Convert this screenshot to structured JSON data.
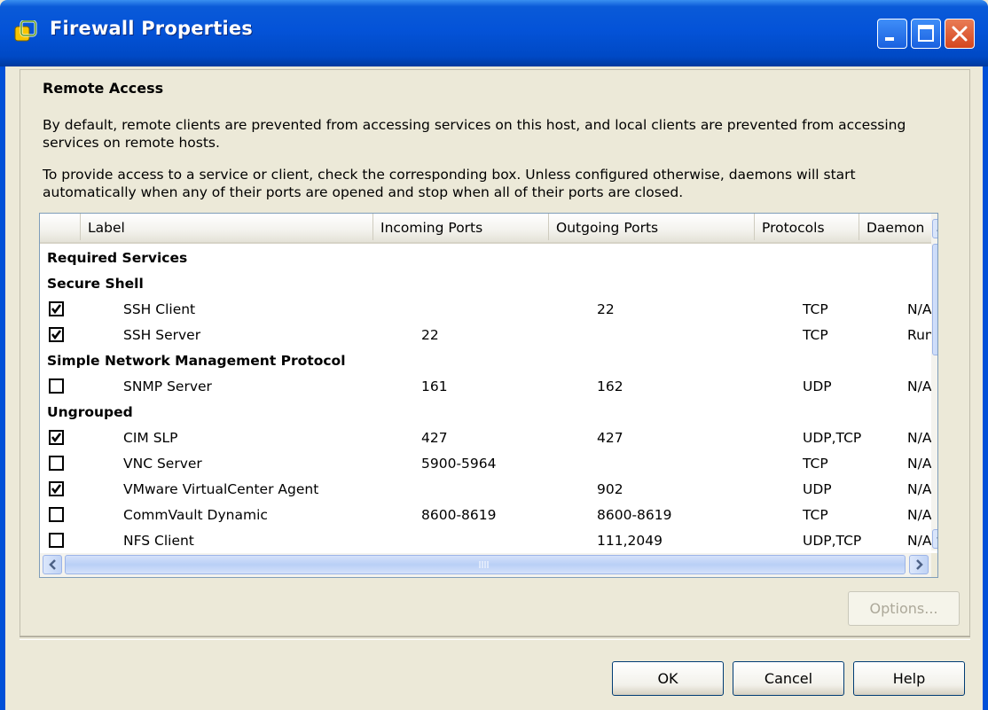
{
  "window": {
    "title": "Firewall Properties"
  },
  "remote_access": {
    "heading": "Remote Access",
    "para1": "By default, remote clients are prevented from accessing services on this host, and local clients are prevented from accessing services on remote hosts.",
    "para2": "To provide access to a service or client, check the corresponding box. Unless configured otherwise, daemons will start automatically when any of their ports are opened and stop when all of their ports are closed."
  },
  "table": {
    "columns": [
      "Label",
      "Incoming Ports",
      "Outgoing Ports",
      "Protocols",
      "Daemon"
    ],
    "rows": [
      {
        "group": "Required Services"
      },
      {
        "group": "Secure Shell"
      },
      {
        "checked": true,
        "label": "SSH Client",
        "incoming": "",
        "outgoing": "22",
        "protocols": "TCP",
        "daemon": "N/A"
      },
      {
        "checked": true,
        "label": "SSH Server",
        "incoming": "22",
        "outgoing": "",
        "protocols": "TCP",
        "daemon": "Running"
      },
      {
        "group": "Simple Network Management Protocol"
      },
      {
        "checked": false,
        "label": "SNMP Server",
        "incoming": "161",
        "outgoing": "162",
        "protocols": "UDP",
        "daemon": "N/A"
      },
      {
        "group": "Ungrouped"
      },
      {
        "checked": true,
        "label": "CIM SLP",
        "incoming": "427",
        "outgoing": "427",
        "protocols": "UDP,TCP",
        "daemon": "N/A"
      },
      {
        "checked": false,
        "label": "VNC Server",
        "incoming": "5900-5964",
        "outgoing": "",
        "protocols": "TCP",
        "daemon": "N/A"
      },
      {
        "checked": true,
        "label": "VMware VirtualCenter Agent",
        "incoming": "",
        "outgoing": "902",
        "protocols": "UDP",
        "daemon": "N/A"
      },
      {
        "checked": false,
        "label": "CommVault Dynamic",
        "incoming": "8600-8619",
        "outgoing": "8600-8619",
        "protocols": "TCP",
        "daemon": "N/A"
      },
      {
        "checked": false,
        "label": "NFS Client",
        "incoming": "",
        "outgoing": "111,2049",
        "protocols": "UDP,TCP",
        "daemon": "N/A"
      }
    ]
  },
  "buttons": {
    "options": "Options...",
    "ok": "OK",
    "cancel": "Cancel",
    "help": "Help"
  },
  "colors": {
    "titlebar": "#0453d8",
    "dialog_bg": "#ece9d8",
    "close_button": "#d4461f"
  }
}
